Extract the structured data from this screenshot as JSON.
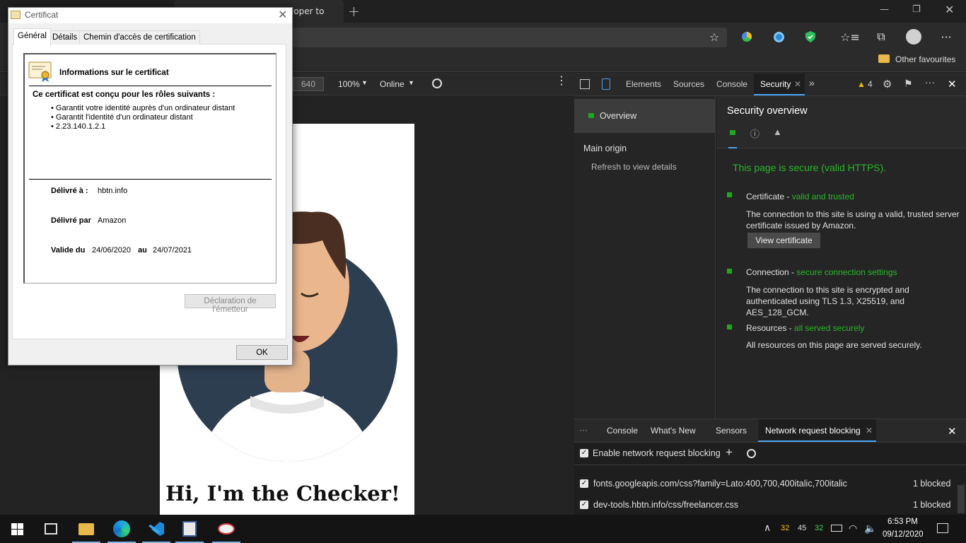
{
  "browser": {
    "tab_title_fragment": "loper to",
    "other_favourites": "Other favourites"
  },
  "emulation": {
    "height_value": "640",
    "zoom": "100%",
    "throttling": "Online"
  },
  "page": {
    "heading": "Hi, I'm the Checker!"
  },
  "devtools": {
    "tabs": [
      "Elements",
      "Sources",
      "Console",
      "Security"
    ],
    "active_tab": "Security",
    "warning_count": "4",
    "sidebar": {
      "overview": "Overview",
      "main_origin": "Main origin",
      "refresh": "Refresh to view details"
    },
    "security": {
      "title": "Security overview",
      "summary": "This page is secure (valid HTTPS).",
      "certificate_label": "Certificate - ",
      "certificate_status": "valid and trusted",
      "certificate_desc": "The connection to this site is using a valid, trusted server certificate issued by Amazon.",
      "view_certificate": "View certificate",
      "connection_label": "Connection - ",
      "connection_status": "secure connection settings",
      "connection_desc": "The connection to this site is encrypted and authenticated using TLS 1.3, X25519, and AES_128_GCM.",
      "resources_label": "Resources - ",
      "resources_status": "all served securely",
      "resources_desc": "All resources on this page are served securely."
    },
    "drawer": {
      "tabs": [
        "Console",
        "What's New",
        "Sensors",
        "Network request blocking"
      ],
      "active_tab": "Network request blocking",
      "enable_label": "Enable network request blocking",
      "rows": [
        {
          "pattern": "fonts.googleapis.com/css?family=Lato:400,700,400italic,700italic",
          "count": "1 blocked"
        },
        {
          "pattern": "dev-tools.hbtn.info/css/freelancer.css",
          "count": "1 blocked"
        }
      ]
    }
  },
  "dialog": {
    "title": "Certificat",
    "tabs": [
      "Général",
      "Détails",
      "Chemin d'accès de certification"
    ],
    "heading": "Informations sur le certificat",
    "roles_title": "Ce certificat est conçu pour les rôles suivants :",
    "roles": [
      "• Garantit votre identité auprès d'un ordinateur distant",
      "• Garantit l'identité d'un ordinateur distant",
      "• 2.23.140.1.2.1"
    ],
    "issued_to_label": "Délivré à :",
    "issued_to": "hbtn.info",
    "issued_by_label": "Délivré par",
    "issued_by": "Amazon",
    "valid_label": "Valide du",
    "valid_from": "24/06/2020",
    "valid_au": "au",
    "valid_to": "24/07/2021",
    "issuer_statement": "Déclaration de l'émetteur",
    "ok": "OK"
  },
  "taskbar": {
    "time": "6:53 PM",
    "date": "09/12/2020",
    "tray_nums": [
      "32",
      "45",
      "32"
    ]
  },
  "colors": {
    "secure_green": "#28b828",
    "accent_blue": "#4aa3f0"
  }
}
